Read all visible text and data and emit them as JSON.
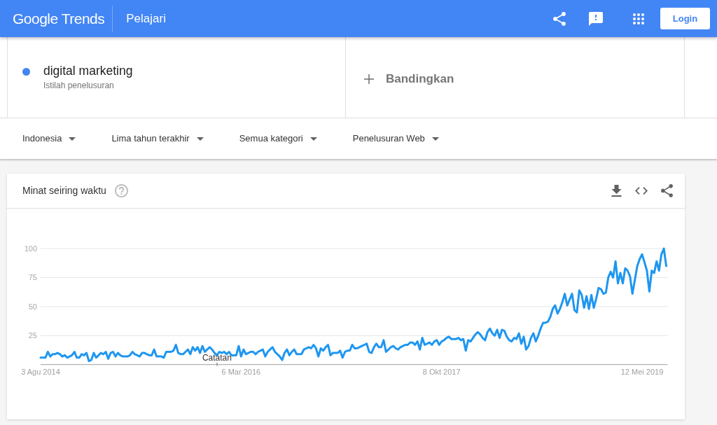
{
  "header": {
    "logo": "Google Trends",
    "title": "Pelajari",
    "login": "Login"
  },
  "terms": [
    {
      "term": "digital marketing",
      "subtitle": "Istilah penelusuran",
      "color": "#4285f4"
    }
  ],
  "compare": {
    "label": "Bandingkan"
  },
  "filters": [
    "Indonesia",
    "Lima tahun terakhir",
    "Semua kategori",
    "Penelusuran Web"
  ],
  "interest_card": {
    "title": "Minat seiring waktu",
    "chart_data": {
      "type": "line",
      "categories": [
        "3 Agu 2014",
        null,
        null,
        null,
        null,
        null,
        null,
        null,
        null,
        null,
        null,
        null,
        null,
        null,
        null,
        null,
        null,
        null,
        null,
        null,
        null,
        null,
        null,
        null,
        null,
        null,
        null,
        null,
        null,
        null,
        null,
        null,
        null,
        null,
        null,
        null,
        null,
        null,
        null,
        null,
        null,
        null,
        null,
        null,
        null,
        null,
        null,
        null,
        null,
        null,
        null,
        null,
        null,
        null,
        null,
        null,
        null,
        null,
        null,
        null,
        null,
        null,
        null,
        null,
        null,
        null,
        null,
        null,
        null,
        null,
        null,
        null,
        null,
        null,
        null,
        null,
        null,
        null,
        null,
        null,
        null,
        null,
        null,
        "6 Mar 2016",
        null,
        null,
        null,
        null,
        null,
        null,
        null,
        null,
        null,
        null,
        null,
        null,
        null,
        null,
        null,
        null,
        null,
        null,
        null,
        null,
        null,
        null,
        null,
        null,
        null,
        null,
        null,
        null,
        null,
        null,
        null,
        null,
        null,
        null,
        null,
        null,
        null,
        null,
        null,
        null,
        null,
        null,
        null,
        null,
        null,
        null,
        null,
        null,
        null,
        null,
        null,
        null,
        null,
        null,
        null,
        null,
        null,
        null,
        null,
        null,
        null,
        null,
        null,
        null,
        null,
        null,
        null,
        null,
        null,
        null,
        null,
        null,
        null,
        null,
        null,
        null,
        null,
        null,
        null,
        null,
        null,
        null,
        "8 Okt 2017",
        null,
        null,
        null,
        null,
        null,
        null,
        null,
        null,
        null,
        null,
        null,
        null,
        null,
        null,
        null,
        null,
        null,
        null,
        null,
        null,
        null,
        null,
        null,
        null,
        null,
        null,
        null,
        null,
        null,
        null,
        null,
        null,
        null,
        null,
        null,
        null,
        null,
        null,
        null,
        null,
        null,
        null,
        null,
        null,
        null,
        null,
        null,
        null,
        null,
        null,
        null,
        null,
        null,
        null,
        null,
        null,
        null,
        null,
        null,
        null,
        null,
        null,
        null,
        null,
        null,
        null,
        null,
        null,
        null,
        null,
        null,
        null,
        null,
        null,
        null,
        null,
        null,
        null,
        null,
        null,
        null,
        null,
        "12 Mei 2019",
        null,
        null,
        null,
        null,
        null,
        null,
        null,
        null,
        null,
        null
      ],
      "series": [
        {
          "color": "#1e96f0",
          "values": [
            6,
            6,
            6,
            11,
            7,
            9,
            9,
            10,
            9,
            7,
            8,
            6,
            7,
            8,
            11,
            6,
            6,
            9,
            8,
            10,
            3,
            4,
            10,
            6,
            8,
            10,
            9,
            11,
            5,
            10,
            11,
            7,
            10,
            8,
            7,
            7,
            7,
            8,
            11,
            9,
            8,
            7,
            10,
            10,
            9,
            8,
            8,
            13,
            7,
            7,
            7,
            6,
            11,
            11,
            11,
            12,
            17,
            10,
            9,
            9,
            11,
            13,
            9,
            15,
            12,
            15,
            10,
            16,
            11,
            13,
            15,
            13,
            10,
            8,
            11,
            10,
            11,
            9,
            11,
            8,
            8,
            8,
            16,
            7,
            13,
            9,
            10,
            11,
            11,
            9,
            11,
            12,
            13,
            7,
            11,
            13,
            15,
            11,
            9,
            7,
            4,
            10,
            13,
            8,
            11,
            13,
            9,
            9,
            9,
            13,
            14,
            15,
            14,
            17,
            14,
            7,
            14,
            12,
            15,
            17,
            8,
            10,
            10,
            10,
            12,
            6,
            11,
            12,
            12,
            17,
            14,
            14,
            15,
            16,
            17,
            18,
            11,
            10,
            15,
            18,
            15,
            15,
            21,
            11,
            13,
            15,
            16,
            14,
            13,
            15,
            16,
            17,
            17,
            19,
            19,
            17,
            20,
            13,
            23,
            17,
            18,
            19,
            17,
            20,
            21,
            17,
            20,
            21,
            23,
            24,
            22,
            22,
            22,
            23,
            21,
            22,
            12,
            21,
            20,
            23,
            26,
            28,
            26,
            23,
            21,
            28,
            31,
            27,
            25,
            30,
            23,
            30,
            29,
            24,
            21,
            20,
            23,
            22,
            27,
            18,
            24,
            13,
            16,
            23,
            27,
            20,
            25,
            31,
            36,
            36,
            37,
            41,
            48,
            51,
            44,
            48,
            54,
            61,
            51,
            56,
            61,
            47,
            45,
            64,
            60,
            49,
            59,
            48,
            60,
            49,
            57,
            66,
            65,
            61,
            62,
            75,
            80,
            75,
            89,
            70,
            79,
            70,
            83,
            81,
            76,
            61,
            73,
            85,
            91,
            95,
            88,
            81,
            63,
            81,
            79,
            89,
            81,
            95,
            100,
            85
          ]
        }
      ],
      "ylim": [
        0,
        100
      ],
      "yticks": [
        25,
        50,
        75,
        100
      ],
      "grid": true,
      "annotations": [
        {
          "text": "Catatan"
        }
      ]
    }
  }
}
